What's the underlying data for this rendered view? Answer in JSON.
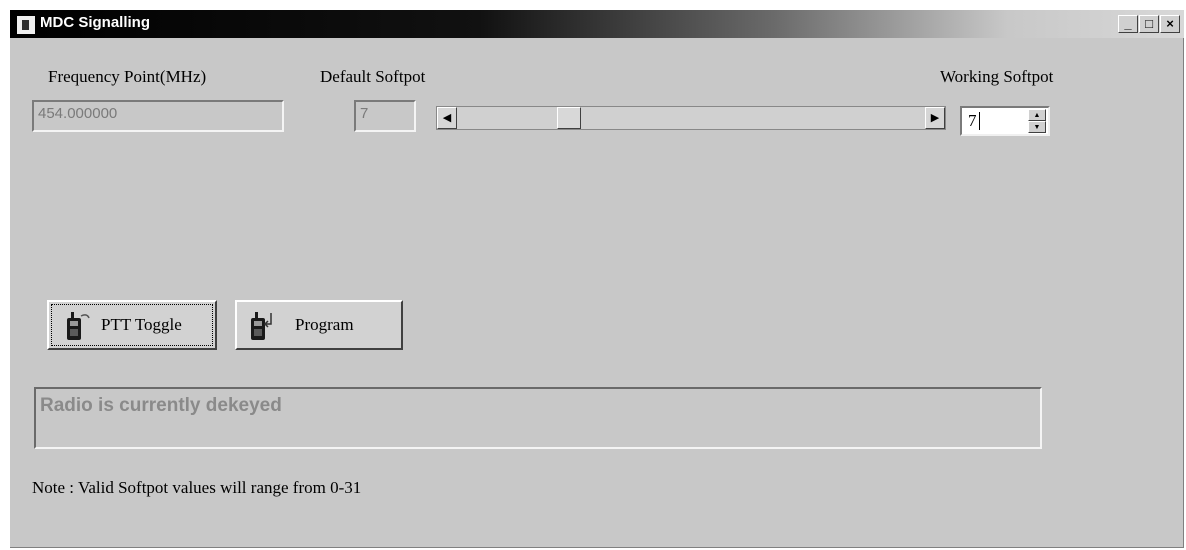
{
  "window": {
    "title": "MDC Signalling",
    "controls": {
      "minimize": "_",
      "maximize": "□",
      "close": "×"
    }
  },
  "frequency": {
    "label": "Frequency Point(MHz)",
    "value": "454.000000"
  },
  "default_softpot": {
    "label": "Default Softpot",
    "value": "7"
  },
  "slider": {
    "min": 0,
    "max": 31,
    "value": 7
  },
  "working_softpot": {
    "label": "Working Softpot",
    "value": "7"
  },
  "buttons": {
    "ptt_toggle": "PTT Toggle",
    "program": "Program"
  },
  "status": {
    "text": "Radio is currently dekeyed"
  },
  "note": "Note : Valid Softpot values will range from 0-31",
  "icons": {
    "app": "radio-icon",
    "ptt": "radio-ptt-icon",
    "program": "radio-program-icon",
    "scroll_left": "arrow-left-icon",
    "scroll_right": "arrow-right-icon",
    "spin_up": "arrow-up-icon",
    "spin_down": "arrow-down-icon"
  }
}
